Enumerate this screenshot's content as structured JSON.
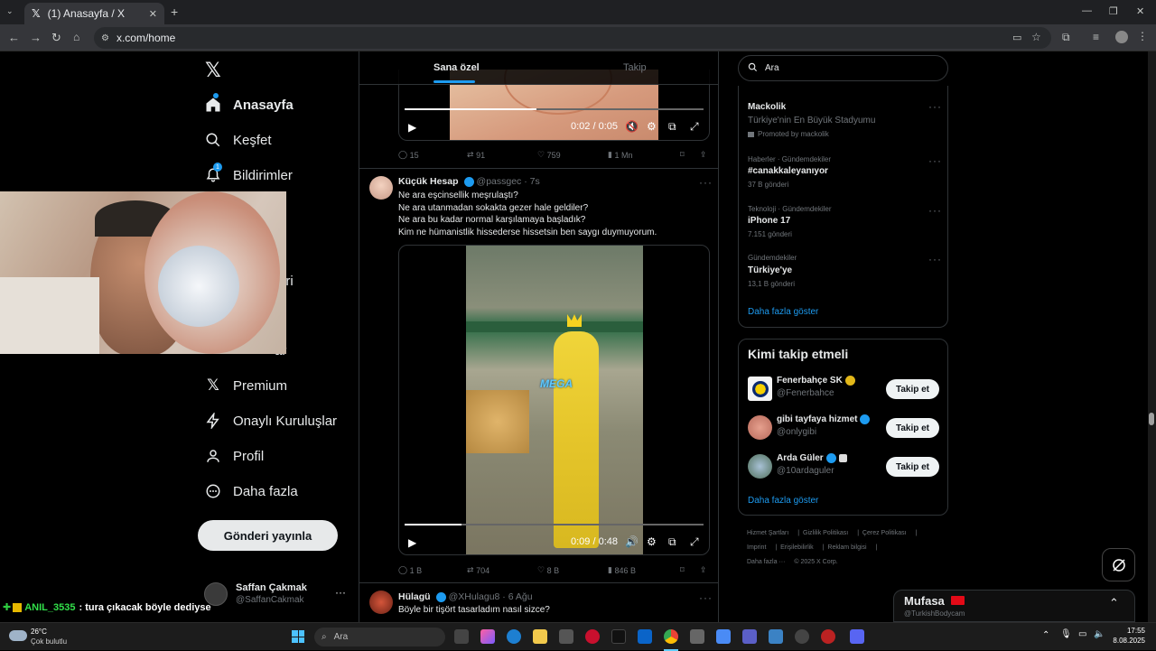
{
  "browser": {
    "tab_title": "(1) Anasayfa / X",
    "url": "x.com/home"
  },
  "colors": {
    "accent": "#1d9bf0",
    "background": "#000000",
    "text": "#e7e9ea",
    "muted": "#71767b",
    "border": "#2f3336"
  },
  "nav": {
    "items": [
      {
        "label": "Anasayfa",
        "icon": "home-icon"
      },
      {
        "label": "Keşfet",
        "icon": "search-icon"
      },
      {
        "label": "Bildirimler",
        "icon": "bell-icon",
        "badge": "1"
      },
      {
        "label": "eri",
        "icon": "bookmark-icon"
      },
      {
        "label": "ar",
        "icon": "communities-icon"
      },
      {
        "label": "Premium",
        "icon": "x-logo-icon"
      },
      {
        "label": "Onaylı Kuruluşlar",
        "icon": "lightning-icon"
      },
      {
        "label": "Profil",
        "icon": "person-icon"
      },
      {
        "label": "Daha fazla",
        "icon": "more-circle-icon"
      }
    ],
    "post_button": "Gönderi yayınla",
    "account": {
      "name": "Saffan Çakmak",
      "handle": "@SaffanCakmak"
    }
  },
  "feed": {
    "tabs": [
      "Sana özel",
      "Takip"
    ],
    "first_video": {
      "time": "0:02 / 0:05",
      "progress": 0.44
    },
    "first_metrics": {
      "replies": "15",
      "reposts": "91",
      "likes": "759",
      "views": "1 Mn"
    },
    "tweet1": {
      "name": "Küçük Hesap",
      "handle": "@passgec",
      "time": "7s",
      "text": "Ne ara eşcinsellik meşrulaştı?\nNe ara utanmadan sokakta gezer hale geldiler?\nNe ara bu kadar normal karşılamaya başladık?\nKim ne hümanistlik hissederse hissetsin ben saygı duymuyorum.",
      "video_watermark": "MEGA",
      "video_time": "0:09 / 0:48",
      "video_progress": 0.19,
      "metrics": {
        "replies": "1 B",
        "reposts": "704",
        "likes": "8 B",
        "views": "846 B"
      }
    },
    "tweet2": {
      "name": "Hülagü",
      "handle": "@XHulagu8",
      "time": "6 Ağu",
      "text": "Böyle bir tişört tasarladım nasıl sizce?"
    }
  },
  "right": {
    "search_placeholder": "Ara",
    "trends": [
      {
        "meta": "",
        "title": "Mackolik",
        "sub": "Türkiye'nin En Büyük Stadyumu",
        "extra": "Promoted by mackolik"
      },
      {
        "meta": "Haberler · Gündemdekiler",
        "title": "#canakkaleyanıyor",
        "sub": "37 B gönderi"
      },
      {
        "meta": "Teknoloji · Gündemdekiler",
        "title": "iPhone 17",
        "sub": "7.151 gönderi"
      },
      {
        "meta": "Gündemdekiler",
        "title": "Türkiye'ye",
        "sub": "13,1 B gönderi"
      }
    ],
    "trends_more": "Daha fazla göster",
    "who_to_follow_title": "Kimi takip etmeli",
    "who_to_follow": [
      {
        "name": "Fenerbahçe SK",
        "handle": "@Fenerbahce",
        "button": "Takip et"
      },
      {
        "name": "gibi tayfaya hizmet",
        "handle": "@onlygibi",
        "button": "Takip et"
      },
      {
        "name": "Arda Güler",
        "handle": "@10ardaguler",
        "button": "Takip et"
      }
    ],
    "follow_more": "Daha fazla göster",
    "footer": [
      "Hizmet Şartları",
      "Gizlilik Politikası",
      "Çerez Politikası",
      "Imprint",
      "Erişilebilirlik",
      "Reklam bilgisi",
      "Daha fazla ···",
      "© 2025 X Corp."
    ]
  },
  "overlays": {
    "chat_user": "ANIL_3535",
    "chat_message": ": tura çıkacak böyle dediyse",
    "stream_name": "Mufasa",
    "stream_handle": "@TurkishBodycam"
  },
  "taskbar": {
    "temp": "26°C",
    "weather": "Çok bulutlu",
    "search": "Ara",
    "time": "17:55",
    "date": "8.08.2025"
  }
}
